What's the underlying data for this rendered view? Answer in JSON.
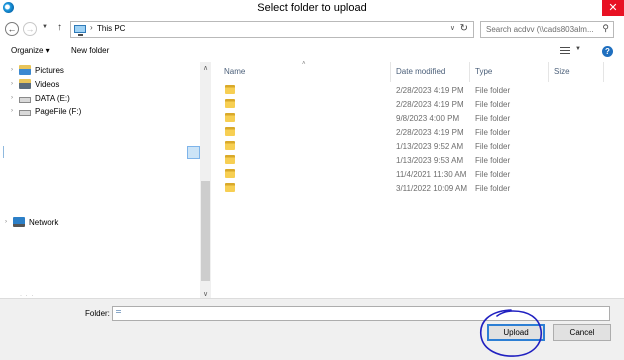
{
  "window": {
    "title": "Select folder to upload",
    "close_glyph": "✕",
    "icon": "edge-browser-icon"
  },
  "navbar": {
    "back_glyph": "←",
    "forward_glyph": "→",
    "recent_glyph": "▼",
    "up_glyph": "↑",
    "address": {
      "icon": "this-pc-icon",
      "separator": "›",
      "path": "This PC",
      "dropdown_glyph": "∨",
      "refresh_glyph": "↻"
    },
    "search": {
      "placeholder": "Search acdvv (\\\\cads803alm...",
      "icon_glyph": "⚲"
    }
  },
  "toolbar": {
    "organize": "Organize ▾",
    "new_folder": "New folder",
    "view_drop_glyph": "▼",
    "help_glyph": "?"
  },
  "nav_tree": [
    {
      "label": "Pictures",
      "icon": "pictures-folder-icon",
      "expander": "›"
    },
    {
      "label": "Videos",
      "icon": "videos-folder-icon",
      "expander": "›"
    },
    {
      "label": "DATA (E:)",
      "icon": "drive-icon",
      "expander": "›"
    },
    {
      "label": "PageFile (F:)",
      "icon": "drive-icon",
      "expander": "›"
    },
    {
      "label": "Network",
      "icon": "network-icon",
      "expander": "›"
    }
  ],
  "scrollbar": {
    "up_glyph": "∧",
    "down_glyph": "∨"
  },
  "file_list": {
    "columns": {
      "name": "Name",
      "date": "Date modified",
      "type": "Type",
      "size": "Size"
    },
    "sort_glyph": "˄",
    "rows": [
      {
        "name": "",
        "date": "2/28/2023 4:19 PM",
        "type": "File folder"
      },
      {
        "name": "",
        "date": "2/28/2023 4:19 PM",
        "type": "File folder"
      },
      {
        "name": "",
        "date": "9/8/2023 4:00 PM",
        "type": "File folder"
      },
      {
        "name": "",
        "date": "2/28/2023 4:19 PM",
        "type": "File folder"
      },
      {
        "name": "",
        "date": "1/13/2023 9:52 AM",
        "type": "File folder"
      },
      {
        "name": "",
        "date": "1/13/2023 9:53 AM",
        "type": "File folder"
      },
      {
        "name": "",
        "date": "11/4/2021 11:30 AM",
        "type": "File folder"
      },
      {
        "name": "",
        "date": "3/11/2022 10:09 AM",
        "type": "File folder"
      }
    ]
  },
  "footer": {
    "folder_label": "Folder:",
    "folder_value": "",
    "upload_label": "Upload",
    "cancel_label": "Cancel",
    "annotation_color": "#2020c0"
  }
}
